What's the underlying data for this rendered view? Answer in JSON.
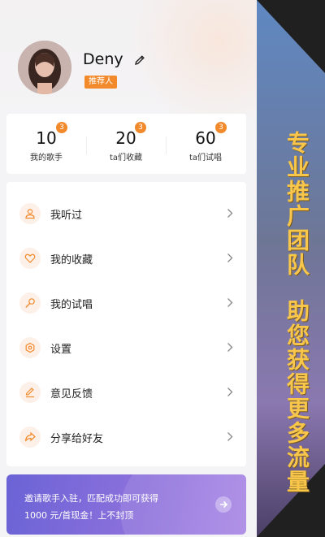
{
  "profile": {
    "name": "Deny",
    "tag": "推荐人"
  },
  "stats": [
    {
      "value": "10",
      "label": "我的歌手",
      "badge": "3"
    },
    {
      "value": "20",
      "label": "ta们收藏",
      "badge": "3"
    },
    {
      "value": "60",
      "label": "ta们试唱",
      "badge": "3"
    }
  ],
  "menu": [
    {
      "label": "我听过",
      "icon": "user-icon"
    },
    {
      "label": "我的收藏",
      "icon": "heart-icon"
    },
    {
      "label": "我的试唱",
      "icon": "microphone-icon"
    },
    {
      "label": "设置",
      "icon": "settings-icon"
    },
    {
      "label": "意见反馈",
      "icon": "edit-icon"
    },
    {
      "label": "分享给好友",
      "icon": "share-icon"
    }
  ],
  "banner": {
    "line1": "邀请歌手入驻，匹配成功即可获得",
    "line2": "1000 元/首现金！上不封顶"
  },
  "side": {
    "line1": "专业推广团队",
    "line2": "助您获得更多流量"
  },
  "colors": {
    "accent": "#f28a2c",
    "banner": "#7b6adb",
    "side_text": "#f7c64a"
  }
}
